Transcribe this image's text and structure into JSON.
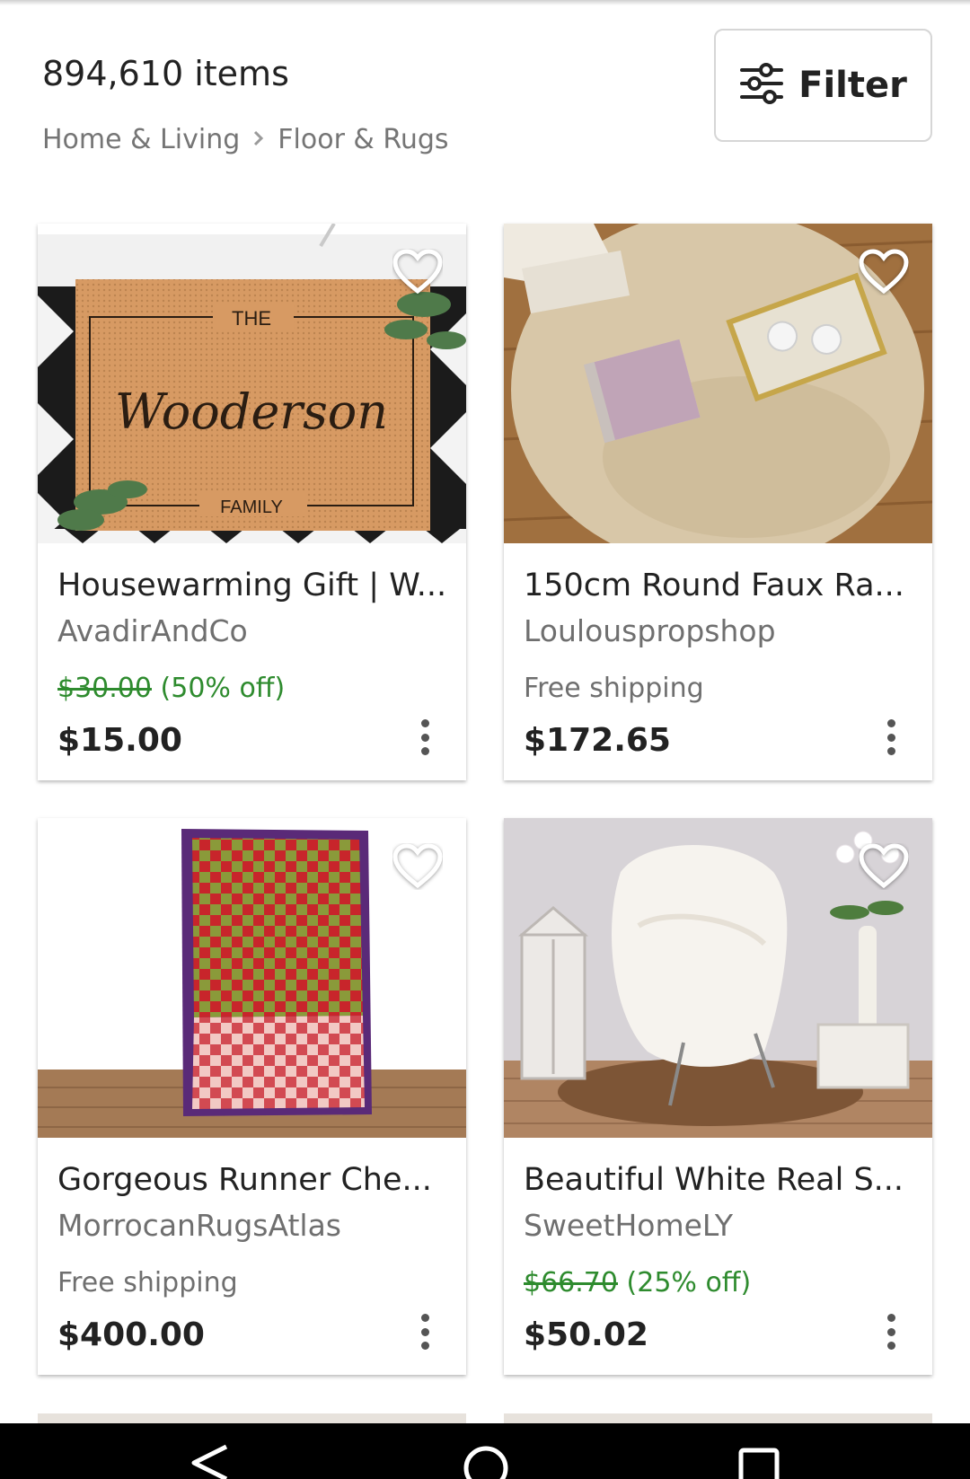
{
  "header": {
    "item_count": "894,610 items",
    "breadcrumb": [
      "Home & Living",
      "Floor & Rugs"
    ],
    "breadcrumb_sep_icon": "chevron-right-icon",
    "filter_label": "Filter",
    "filter_icon": "sliders-icon"
  },
  "listings": [
    {
      "title": "Housewarming Gift | W...",
      "shop": "AvadirAndCo",
      "original_price": "$30.00",
      "discount": "(50% off)",
      "shipping": "",
      "price": "$15.00",
      "image_text": [
        "THE",
        "Wooderson",
        "FAMILY"
      ]
    },
    {
      "title": "150cm Round Faux Ra...",
      "shop": "Loulouspropshop",
      "original_price": "",
      "discount": "",
      "shipping": "Free shipping",
      "price": "$172.65"
    },
    {
      "title": "Gorgeous Runner Che...",
      "shop": "MorrocanRugsAtlas",
      "original_price": "",
      "discount": "",
      "shipping": "Free shipping",
      "price": "$400.00"
    },
    {
      "title": "Beautiful White Real S...",
      "shop": "SweetHomeLY",
      "original_price": "$66.70",
      "discount": "(25% off)",
      "shipping": "",
      "price": "$50.02"
    }
  ],
  "colors": {
    "discount_green": "#2e8b2e",
    "muted_text": "#6f6f6f",
    "navbar": "#000000"
  },
  "icons": [
    "heart-outline-icon",
    "more-vertical-icon",
    "back-nav-icon",
    "home-nav-icon",
    "recents-nav-icon"
  ]
}
